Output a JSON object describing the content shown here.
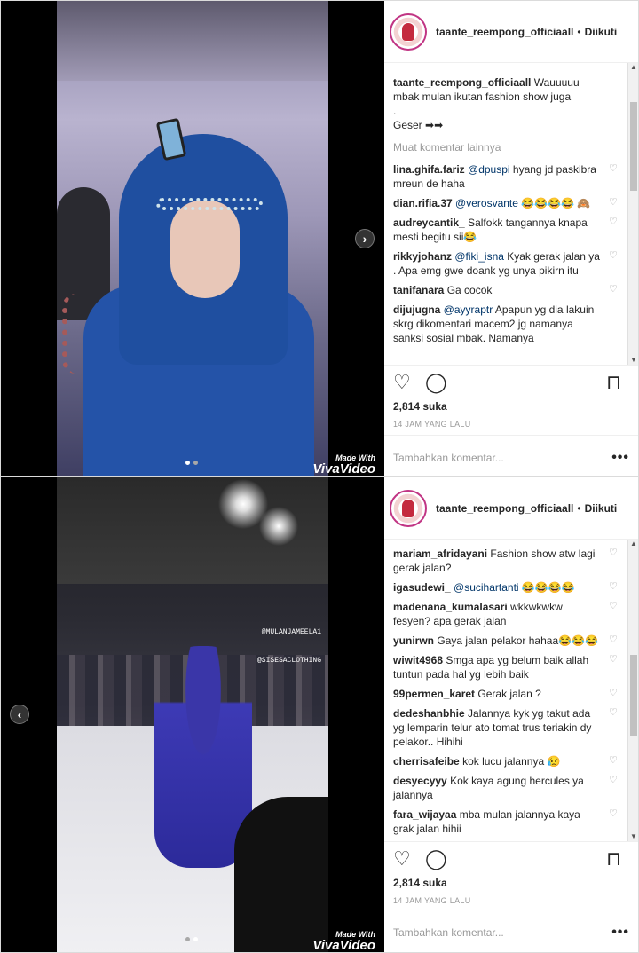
{
  "posts": [
    {
      "account": "taante_reempong_officiaall",
      "follow_status": "Diikuti",
      "caption": {
        "user": "taante_reempong_officiaall",
        "text_line1": "Wauuuuu mbak mulan ikutan fashion show juga",
        "text_line2": ".",
        "text_line3": "Geser ➡➡"
      },
      "load_more": "Muat komentar lainnya",
      "comments": [
        {
          "user": "lina.ghifa.fariz",
          "mention": "@dpuspi",
          "text": " hyang jd paskibra mreun de haha"
        },
        {
          "user": "dian.rifia.37",
          "mention": "@verosvante",
          "text": " 😂😂😂😂 🙈"
        },
        {
          "user": "audreycantik_",
          "mention": "",
          "text": "Salfokk tangannya knapa mesti begitu sii😂"
        },
        {
          "user": "rikkyjohanz",
          "mention": "@fiki_isna",
          "text": " Kyak gerak jalan ya . Apa emg gwe doank yg unya pikirn itu"
        },
        {
          "user": "tanifanara",
          "mention": "",
          "text": "Ga cocok"
        },
        {
          "user": "dijujugna",
          "mention": "@ayyraptr",
          "text": " Apapun yg dia lakuin skrg dikomentari macem2 jg namanya sanksi sosial mbak. Namanya"
        }
      ],
      "likes": "2,814 suka",
      "time": "14 JAM YANG LALU",
      "add_comment_placeholder": "Tambahkan komentar...",
      "more_label": "•••",
      "watermark_small": "Made With",
      "watermark_big": "VivaVideo",
      "nav_arrow": "›"
    },
    {
      "account": "taante_reempong_officiaall",
      "follow_status": "Diikuti",
      "comments": [
        {
          "user": "mariam_afridayani",
          "mention": "",
          "text": "Fashion show atw lagi gerak jalan?"
        },
        {
          "user": "igasudewi_",
          "mention": "@sucihartanti",
          "text": " 😂😂😂😂"
        },
        {
          "user": "madenana_kumalasari",
          "mention": "",
          "text": "wkkwkwkw fesyen? apa gerak jalan"
        },
        {
          "user": "yunirwn",
          "mention": "",
          "text": "Gaya jalan pelakor hahaa😂😂😂"
        },
        {
          "user": "wiwit4968",
          "mention": "",
          "text": "Smga apa yg belum baik allah tuntun pada hal yg lebih baik"
        },
        {
          "user": "99permen_karet",
          "mention": "",
          "text": "Gerak jalan ?"
        },
        {
          "user": "dedeshanbhie",
          "mention": "",
          "text": "Jalannya kyk yg takut ada yg lemparin telur ato tomat trus teriakin dy pelakor.. Hihihi"
        },
        {
          "user": "cherrisafeibe",
          "mention": "",
          "text": "kok lucu jalannya 😥"
        },
        {
          "user": "desyecyyy",
          "mention": "",
          "text": "Kok kaya agung hercules ya jalannya"
        },
        {
          "user": "fara_wijayaa",
          "mention": "",
          "text": "mba mulan jalannya kaya grak jalan hihii"
        }
      ],
      "likes": "2,814 suka",
      "time": "14 JAM YANG LALU",
      "add_comment_placeholder": "Tambahkan komentar...",
      "more_label": "•••",
      "watermark_small": "Made With",
      "watermark_big": "VivaVideo",
      "overlay_tag_1": "@MULANJAMEELA1",
      "overlay_tag_2": "@SISESACLOTHING",
      "nav_arrow": "‹"
    }
  ],
  "icons": {
    "heart": "♡",
    "comment": "◯",
    "bookmark": "⊓"
  }
}
